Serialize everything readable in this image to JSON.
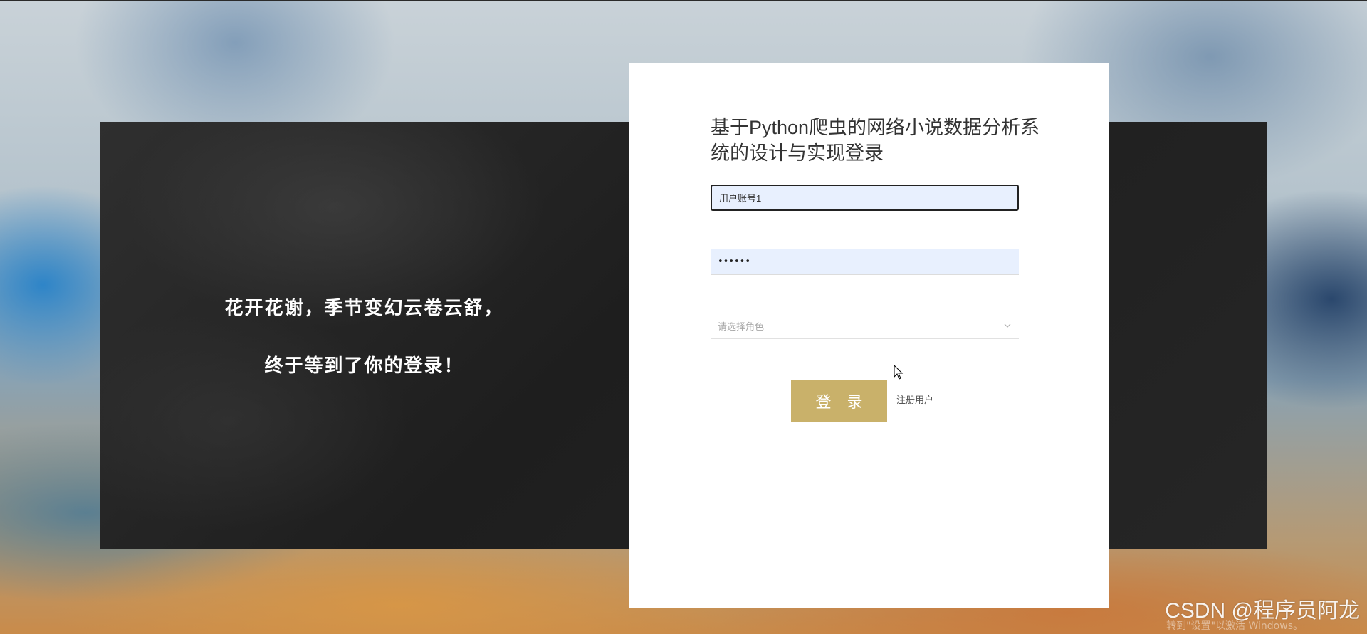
{
  "slogan": {
    "line1": "花开花谢，季节变幻云卷云舒，",
    "line2": "终于等到了你的登录！"
  },
  "login_form": {
    "title": "基于Python爬虫的网络小说数据分析系统的设计与实现登录",
    "username_value": "用户账号1",
    "password_value": "••••••",
    "role_placeholder": "请选择角色",
    "login_label": "登 录",
    "register_label": "注册用户"
  },
  "icons": {
    "role_dropdown": "chevron-down-icon",
    "cursor": "mouse-pointer-icon"
  },
  "overlay": {
    "watermark": "CSDN @程序员阿龙",
    "windows_notice": "转到\"设置\"以激活 Windows。"
  },
  "colors": {
    "button": "#c9b16a",
    "input_fill": "#e8f0fe",
    "panel_dark": "#1e1e1e"
  }
}
